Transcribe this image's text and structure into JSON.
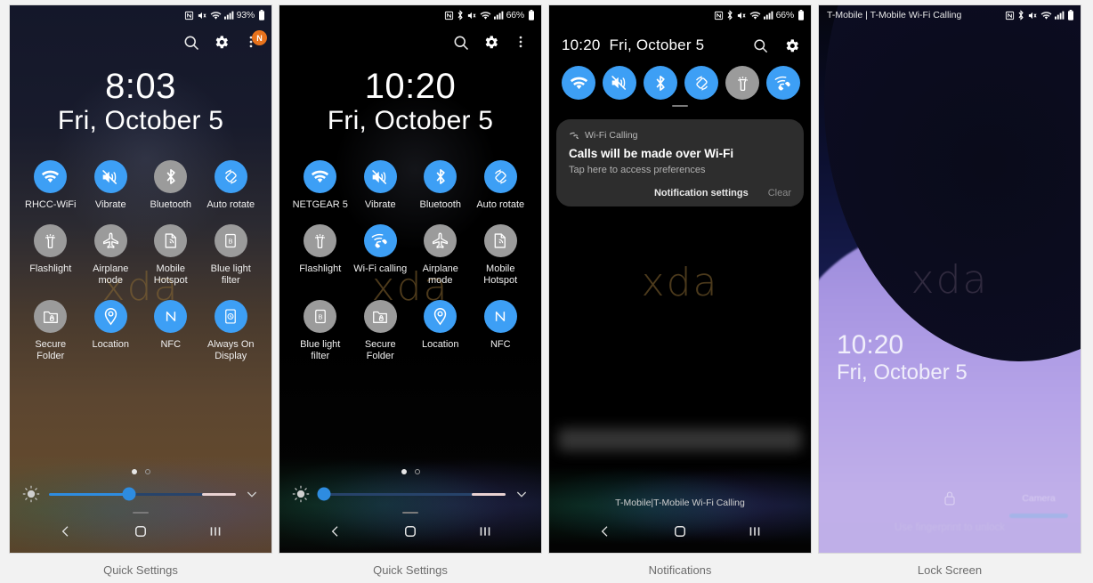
{
  "panels": [
    {
      "caption": "Quick Settings",
      "status": {
        "battery": "93%",
        "icons": [
          "nfc-icon",
          "mute-icon",
          "wifi-icon",
          "signal-icon",
          "battery-icon"
        ]
      },
      "header": {
        "search": "search-icon",
        "settings": "gear-icon",
        "menu": "more-vert-icon",
        "badge": "N"
      },
      "clock": {
        "time": "8:03",
        "date": "Fri, October 5"
      },
      "watermark": "xda",
      "tiles": [
        {
          "label": "RHCC-WiFi",
          "icon": "wifi-icon",
          "state": "on"
        },
        {
          "label": "Vibrate",
          "icon": "vibrate-icon",
          "state": "on"
        },
        {
          "label": "Bluetooth",
          "icon": "bluetooth-icon",
          "state": "off"
        },
        {
          "label": "Auto rotate",
          "icon": "auto-rotate-icon",
          "state": "on"
        },
        {
          "label": "Flashlight",
          "icon": "flashlight-icon",
          "state": "off"
        },
        {
          "label": "Airplane mode",
          "icon": "airplane-icon",
          "state": "off"
        },
        {
          "label": "Mobile Hotspot",
          "icon": "hotspot-icon",
          "state": "off"
        },
        {
          "label": "Blue light filter",
          "icon": "blue-light-icon",
          "state": "off"
        },
        {
          "label": "Secure Folder",
          "icon": "secure-folder-icon",
          "state": "off"
        },
        {
          "label": "Location",
          "icon": "location-icon",
          "state": "on"
        },
        {
          "label": "NFC",
          "icon": "nfc-icon",
          "state": "on"
        },
        {
          "label": "Always On Display",
          "icon": "always-on-display-icon",
          "state": "on"
        }
      ],
      "pages": {
        "current": 1,
        "total": 2
      },
      "brightness": {
        "percent": 43
      },
      "nav": {
        "back": "back-icon",
        "home": "home-icon",
        "recents": "recents-icon"
      }
    },
    {
      "caption": "Quick Settings",
      "status": {
        "battery": "66%",
        "icons": [
          "nfc-icon",
          "bluetooth-icon",
          "mute-icon",
          "wifi-icon",
          "signal-icon",
          "battery-icon"
        ]
      },
      "header": {
        "search": "search-icon",
        "settings": "gear-icon",
        "menu": "more-vert-icon"
      },
      "clock": {
        "time": "10:20",
        "date": "Fri, October 5"
      },
      "watermark": "xda",
      "tiles": [
        {
          "label": "NETGEAR 5",
          "icon": "wifi-icon",
          "state": "on"
        },
        {
          "label": "Vibrate",
          "icon": "vibrate-icon",
          "state": "on"
        },
        {
          "label": "Bluetooth",
          "icon": "bluetooth-icon",
          "state": "on"
        },
        {
          "label": "Auto rotate",
          "icon": "auto-rotate-icon",
          "state": "on"
        },
        {
          "label": "Flashlight",
          "icon": "flashlight-icon",
          "state": "off"
        },
        {
          "label": "Wi-Fi calling",
          "icon": "wifi-calling-icon",
          "state": "on"
        },
        {
          "label": "Airplane mode",
          "icon": "airplane-icon",
          "state": "off"
        },
        {
          "label": "Mobile Hotspot",
          "icon": "hotspot-icon",
          "state": "off"
        },
        {
          "label": "Blue light filter",
          "icon": "blue-light-icon",
          "state": "off"
        },
        {
          "label": "Secure Folder",
          "icon": "secure-folder-icon",
          "state": "off"
        },
        {
          "label": "Location",
          "icon": "location-icon",
          "state": "on"
        },
        {
          "label": "NFC",
          "icon": "nfc-icon",
          "state": "on"
        }
      ],
      "pages": {
        "current": 1,
        "total": 2
      },
      "brightness": {
        "percent": 3
      },
      "nav": {
        "back": "back-icon",
        "home": "home-icon",
        "recents": "recents-icon"
      }
    },
    {
      "caption": "Notifications",
      "status": {
        "battery": "66%",
        "icons": [
          "nfc-icon",
          "bluetooth-icon",
          "mute-icon",
          "wifi-icon",
          "signal-icon",
          "battery-icon"
        ]
      },
      "header": {
        "time": "10:20",
        "date": "Fri, October 5",
        "search": "search-icon",
        "settings": "gear-icon"
      },
      "quick_tiles": [
        {
          "icon": "wifi-icon",
          "state": "on",
          "name": "wifi"
        },
        {
          "icon": "vibrate-icon",
          "state": "on",
          "name": "vibrate"
        },
        {
          "icon": "bluetooth-icon",
          "state": "on",
          "name": "bluetooth"
        },
        {
          "icon": "auto-rotate-icon",
          "state": "on",
          "name": "auto-rotate"
        },
        {
          "icon": "flashlight-icon",
          "state": "off",
          "name": "flashlight"
        },
        {
          "icon": "wifi-calling-icon",
          "state": "on",
          "name": "wifi-calling"
        }
      ],
      "notification": {
        "app": "Wi-Fi Calling",
        "app_icon": "wifi-calling-icon",
        "title": "Calls will be made over Wi-Fi",
        "subtitle": "Tap here to access preferences",
        "settings_label": "Notification settings",
        "clear_label": "Clear"
      },
      "watermark": "xda",
      "carrier_footer": "T-Mobile|T-Mobile Wi-Fi Calling",
      "nav": {
        "back": "back-icon",
        "home": "home-icon",
        "recents": "recents-icon"
      }
    },
    {
      "caption": "Lock Screen",
      "status": {
        "carrier": "T-Mobile | T-Mobile Wi-Fi Calling",
        "icons": [
          "nfc-icon",
          "bluetooth-icon",
          "mute-icon",
          "wifi-icon",
          "signal-icon",
          "battery-icon"
        ]
      },
      "clock": {
        "time": "10:20",
        "date": "Fri, October 5"
      },
      "watermark": "xda",
      "lock_icon": "lock-icon",
      "hint": "Use fingerprint to unlock",
      "camera_label": "Camera"
    }
  ],
  "colors": {
    "accent_on": "#3d9ff5",
    "accent_off": "#9b9b9b",
    "badge": "#e8721c",
    "slider": "#2e8ce0",
    "watermark": "#8a6a33"
  }
}
